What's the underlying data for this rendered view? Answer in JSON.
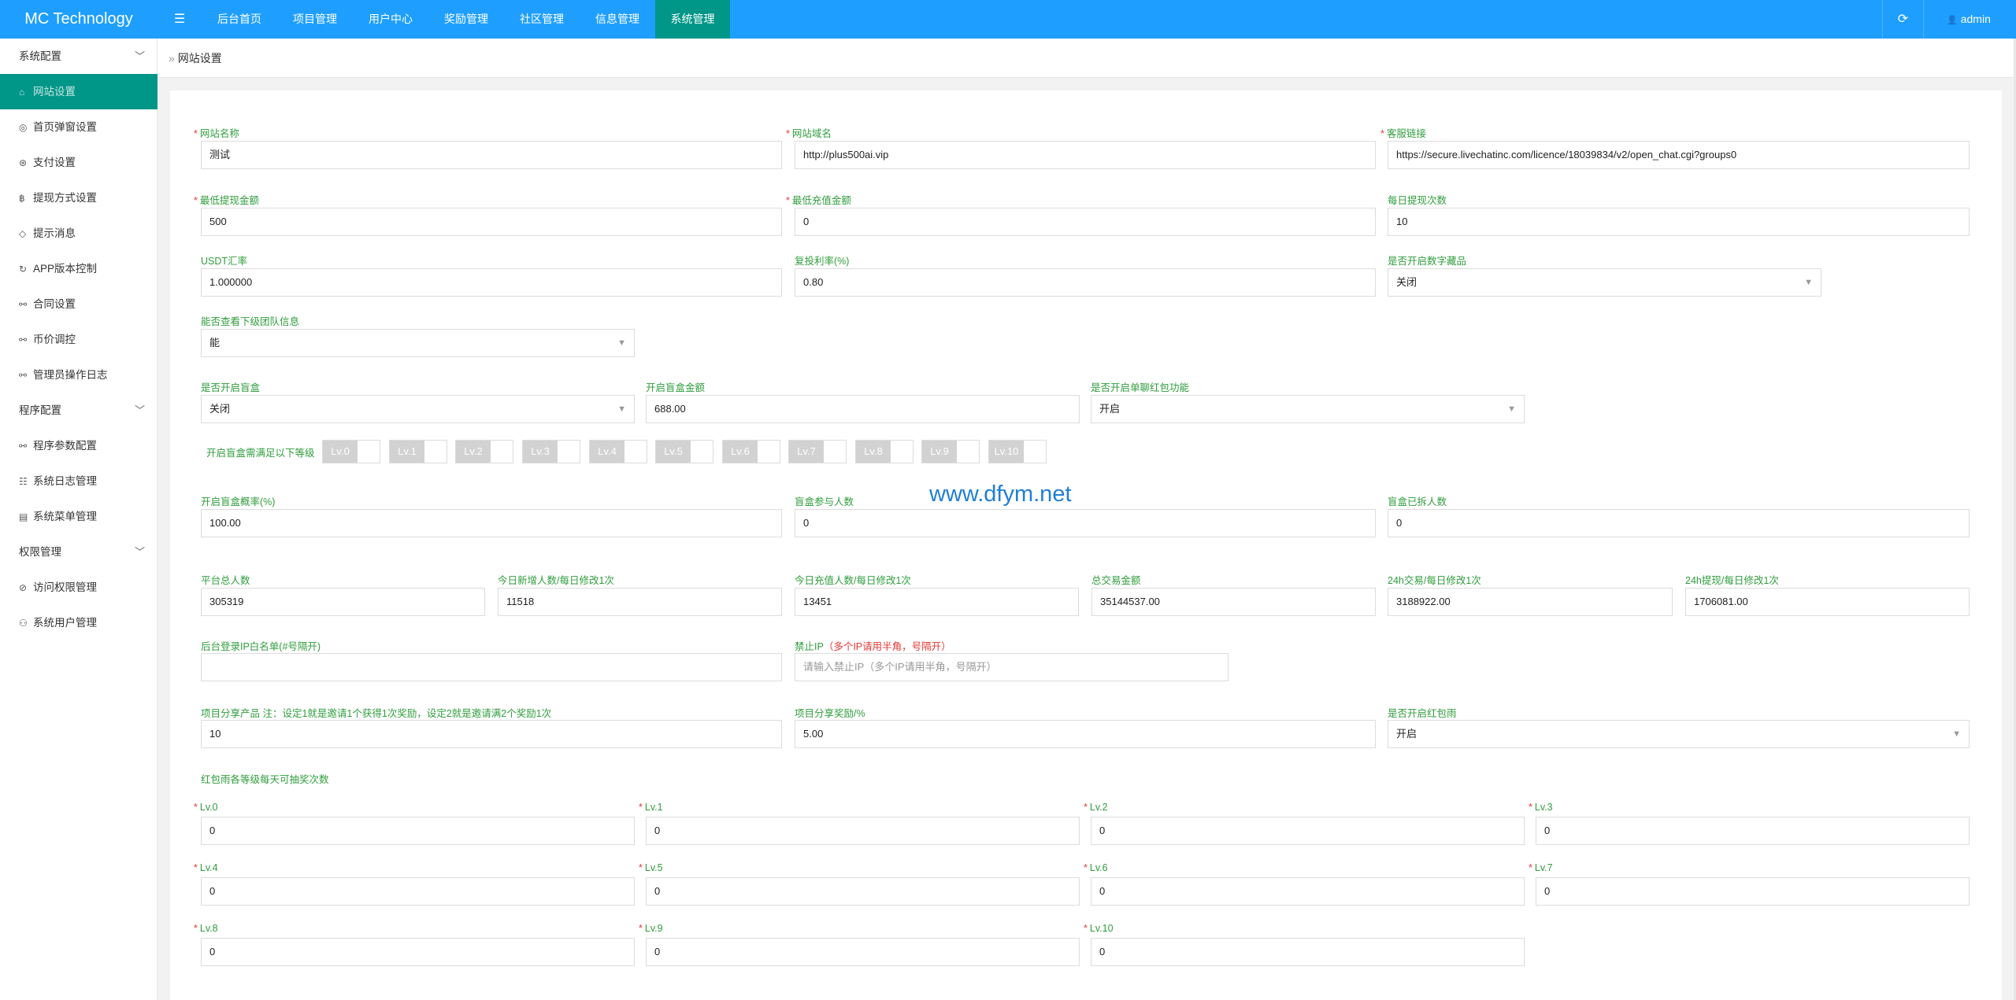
{
  "header": {
    "brand": "MC Technology",
    "menu_icon": "☰",
    "nav": [
      "后台首页",
      "项目管理",
      "用户中心",
      "奖励管理",
      "社区管理",
      "信息管理",
      "系统管理"
    ],
    "refresh_icon": "⟳",
    "user_icon": "👤",
    "user": "admin"
  },
  "sidebar": {
    "groups": [
      {
        "label": "系统配置",
        "chevron": "﹀"
      },
      {
        "label": "程序配置",
        "chevron": "﹀"
      },
      {
        "label": "权限管理",
        "chevron": "﹀"
      }
    ],
    "items": [
      {
        "icon": "⌂",
        "label": "网站设置"
      },
      {
        "icon": "◎",
        "label": "首页弹窗设置"
      },
      {
        "icon": "⊛",
        "label": "支付设置"
      },
      {
        "icon": "฿",
        "label": "提现方式设置"
      },
      {
        "icon": "◇",
        "label": "提示消息"
      },
      {
        "icon": "↻",
        "label": "APP版本控制"
      },
      {
        "icon": "⚯",
        "label": "合同设置"
      },
      {
        "icon": "⚯",
        "label": "币价调控"
      },
      {
        "icon": "⚯",
        "label": "管理员操作日志"
      },
      {
        "icon": "⚯",
        "label": "程序参数配置"
      },
      {
        "icon": "☷",
        "label": "系统日志管理"
      },
      {
        "icon": "▤",
        "label": "系统菜单管理"
      },
      {
        "icon": "⊘",
        "label": "访问权限管理"
      },
      {
        "icon": "⚇",
        "label": "系统用户管理"
      }
    ]
  },
  "breadcrumb": {
    "sep": "»",
    "current": "网站设置"
  },
  "form": {
    "required_mark": "*",
    "site_name": {
      "label": "网站名称",
      "value": "测试"
    },
    "site_domain": {
      "label": "网站域名",
      "value": "http://plus500ai.vip"
    },
    "service_link": {
      "label": "客服链接",
      "value": "https://secure.livechatinc.com/licence/18039834/v2/open_chat.cgi?groups0"
    },
    "min_withdraw": {
      "label": "最低提现金额",
      "value": "500"
    },
    "min_recharge": {
      "label": "最低充值金额",
      "value": "0"
    },
    "daily_withdraw": {
      "label": "每日提现次数",
      "value": "10"
    },
    "usdt_rate": {
      "label": "USDT汇率",
      "value": "1.000000"
    },
    "reinvest_rate": {
      "label": "复投利率(%)",
      "value": "0.80"
    },
    "digital_collection": {
      "label": "是否开启数字藏品",
      "value": "关闭"
    },
    "view_team": {
      "label": "能否查看下级团队信息",
      "value": "能"
    },
    "blind_box": {
      "label": "是否开启盲盒",
      "value": "关闭"
    },
    "blind_box_amount": {
      "label": "开启盲盒金额",
      "value": "688.00"
    },
    "single_redpacket": {
      "label": "是否开启单聊红包功能",
      "value": "开启"
    },
    "level_condition": {
      "label": "开启盲盒需满足以下等级",
      "levels": [
        "Lv.0",
        "Lv.1",
        "Lv.2",
        "Lv.3",
        "Lv.4",
        "Lv.5",
        "Lv.6",
        "Lv.7",
        "Lv.8",
        "Lv.9",
        "Lv.10"
      ]
    },
    "blind_box_prob": {
      "label": "开启盲盒概率(%)",
      "value": "100.00"
    },
    "blind_box_participants": {
      "label": "盲盒参与人数",
      "value": "0"
    },
    "blind_box_opened": {
      "label": "盲盒已拆人数",
      "value": "0"
    },
    "platform_users": {
      "label": "平台总人数",
      "value": "305319"
    },
    "today_new": {
      "label": "今日新增人数/每日修改1次",
      "value": "11518"
    },
    "today_recharge": {
      "label": "今日充值人数/每日修改1次",
      "value": "13451"
    },
    "total_trade": {
      "label": "总交易金额",
      "value": "35144537.00"
    },
    "trade_24h": {
      "label": "24h交易/每日修改1次",
      "value": "3188922.00"
    },
    "withdraw_24h": {
      "label": "24h提现/每日修改1次",
      "value": "1706081.00"
    },
    "ip_whitelist": {
      "label": "后台登录IP白名单(#号隔开)",
      "value": ""
    },
    "ip_ban": {
      "label": "禁止IP",
      "hint": "（多个IP请用半角，号隔开）",
      "placeholder": "请输入禁止IP（多个IP请用半角，号隔开）"
    },
    "project_share": {
      "label": "项目分享产品 注：设定1就是邀请1个获得1次奖励，设定2就是邀请满2个奖励1次",
      "value": "10"
    },
    "project_share_reward": {
      "label": "项目分享奖励/%",
      "value": "5.00"
    },
    "redpacket_rain": {
      "label": "是否开启红包雨",
      "value": "开启"
    },
    "redpacket_levels_title": "红包雨各等级每天可抽奖次数",
    "redpacket_levels": [
      {
        "label": "Lv.0",
        "value": "0"
      },
      {
        "label": "Lv.1",
        "value": "0"
      },
      {
        "label": "Lv.2",
        "value": "0"
      },
      {
        "label": "Lv.3",
        "value": "0"
      },
      {
        "label": "Lv.4",
        "value": "0"
      },
      {
        "label": "Lv.5",
        "value": "0"
      },
      {
        "label": "Lv.6",
        "value": "0"
      },
      {
        "label": "Lv.7",
        "value": "0"
      },
      {
        "label": "Lv.8",
        "value": "0"
      },
      {
        "label": "Lv.9",
        "value": "0"
      },
      {
        "label": "Lv.10",
        "value": "0"
      }
    ]
  },
  "watermark": "www.dfym.net",
  "dropdown_arrow": "▼"
}
